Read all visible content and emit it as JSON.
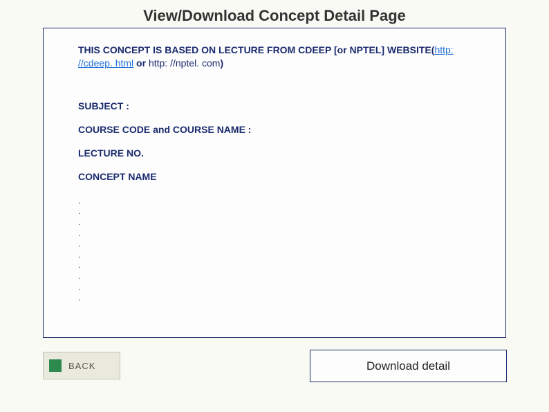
{
  "title": "View/Download Concept Detail Page",
  "intro": {
    "prefix": " THIS CONCEPT IS BASED ON LECTURE FROM  CDEEP [or NPTEL] WEBSITE(",
    "link_text": "http: //cdeep. html",
    "middle": " or ",
    "nptel_text": "http: //nptel. com",
    "suffix": ")"
  },
  "fields": {
    "subject": "SUBJECT :",
    "course": "COURSE  CODE and  COURSE NAME :",
    "lecture": "LECTURE NO.",
    "concept": "CONCEPT NAME"
  },
  "dots": ".\n.\n.\n.\n.\n.\n.\n.\n.\n.",
  "back_label": "BACK",
  "download_label": "Download detail"
}
